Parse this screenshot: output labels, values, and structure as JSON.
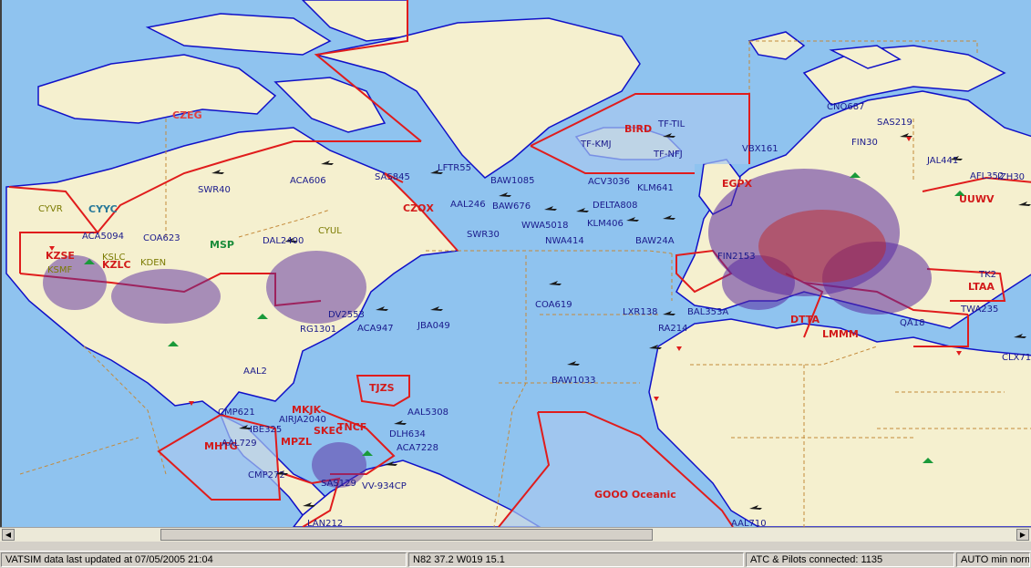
{
  "map": {
    "fir_labels": [
      {
        "id": "fir-czeg",
        "text": "CZEG"
      },
      {
        "id": "fir-bird",
        "text": "BIRD"
      },
      {
        "id": "fir-czqx",
        "text": "CZQX"
      },
      {
        "id": "fir-kzse",
        "text": "KZSE"
      },
      {
        "id": "fir-kzlc",
        "text": "KZLC"
      },
      {
        "id": "fir-ltaa",
        "text": "LTAA"
      },
      {
        "id": "fir-tjzs",
        "text": "TJZS"
      },
      {
        "id": "fir-mkjk",
        "text": "MKJK"
      },
      {
        "id": "fir-mhtg",
        "text": "MHTG"
      },
      {
        "id": "fir-mpzl",
        "text": "MPZL"
      },
      {
        "id": "fir-sken",
        "text": "SKEC"
      },
      {
        "id": "fir-tncf",
        "text": "TNCF"
      },
      {
        "id": "fir-gooo",
        "text": "GOOO Oceanic"
      },
      {
        "id": "fir-egpx",
        "text": "EGPX"
      },
      {
        "id": "fir-lcm",
        "text": "LMMM"
      },
      {
        "id": "fir-uuwv",
        "text": "UUWV"
      },
      {
        "id": "fir-dtta",
        "text": "DTTA"
      }
    ],
    "airport_labels": [
      {
        "id": "apt-cyvr",
        "text": "CYVR"
      },
      {
        "id": "apt-cyul",
        "text": "CYUL"
      },
      {
        "id": "apt-kslc",
        "text": "KSLC"
      },
      {
        "id": "apt-kden",
        "text": "KDEN"
      },
      {
        "id": "apt-ksmf",
        "text": "KSMF"
      }
    ],
    "center_labels": [
      {
        "id": "ctr-cyyc",
        "text": "CYYC"
      },
      {
        "id": "ctr-msp",
        "text": "MSP"
      }
    ],
    "flights": [
      {
        "id": "flt-sas219",
        "text": "SAS219"
      },
      {
        "id": "flt-cno687",
        "text": "CNO687"
      },
      {
        "id": "flt-fin30",
        "text": "FIN30"
      },
      {
        "id": "flt-jal441",
        "text": "JAL441"
      },
      {
        "id": "flt-afl352",
        "text": "AFL352"
      },
      {
        "id": "flt-jzr30",
        "text": "IZH30"
      },
      {
        "id": "flt-vbx161",
        "text": "VBX161"
      },
      {
        "id": "flt-tftil",
        "text": "TF-TIL"
      },
      {
        "id": "flt-tfkmj",
        "text": "TF-KMJ"
      },
      {
        "id": "flt-tfnfj",
        "text": "TF-NFJ"
      },
      {
        "id": "flt-lftr55",
        "text": "LFTR55"
      },
      {
        "id": "flt-baw1085",
        "text": "BAW1085"
      },
      {
        "id": "flt-acv3036",
        "text": "ACV3036"
      },
      {
        "id": "flt-klm641",
        "text": "KLM641"
      },
      {
        "id": "flt-delta808",
        "text": "DELTA808"
      },
      {
        "id": "flt-klm406",
        "text": "KLM406"
      },
      {
        "id": "flt-nwa414",
        "text": "NWA414"
      },
      {
        "id": "flt-baw24a",
        "text": "BAW24A"
      },
      {
        "id": "flt-sas845",
        "text": "SAS845"
      },
      {
        "id": "flt-aca606",
        "text": "ACA606"
      },
      {
        "id": "flt-swr40",
        "text": "SWR40"
      },
      {
        "id": "flt-aal246",
        "text": "AAL246"
      },
      {
        "id": "flt-baw676",
        "text": "BAW676"
      },
      {
        "id": "flt-wwa5018",
        "text": "WWA5018"
      },
      {
        "id": "flt-swr30",
        "text": "SWR30"
      },
      {
        "id": "flt-aca5094",
        "text": "ACA5094"
      },
      {
        "id": "flt-coa623",
        "text": "COA623"
      },
      {
        "id": "flt-dal2400",
        "text": "DAL2400"
      },
      {
        "id": "flt-fin2153",
        "text": "FIN2153"
      },
      {
        "id": "flt-tk2",
        "text": "TK2"
      },
      {
        "id": "flt-coa619",
        "text": "COA619"
      },
      {
        "id": "flt-lxr138",
        "text": "LXR138"
      },
      {
        "id": "flt-bal353a",
        "text": "BAL353A"
      },
      {
        "id": "flt-ra214",
        "text": "RA214"
      },
      {
        "id": "flt-baw1033",
        "text": "BAW1033"
      },
      {
        "id": "flt-aca947",
        "text": "ACA947"
      },
      {
        "id": "flt-jba049",
        "text": "JBA049"
      },
      {
        "id": "flt-dv2553",
        "text": "DV2553"
      },
      {
        "id": "flt-rg1301",
        "text": "RG1301"
      },
      {
        "id": "flt-aal2",
        "text": "AAL2"
      },
      {
        "id": "flt-cmp621",
        "text": "CMP621"
      },
      {
        "id": "flt-ibe325",
        "text": "IBE325"
      },
      {
        "id": "flt-aal729",
        "text": "AAL729"
      },
      {
        "id": "flt-cmp272",
        "text": "CMP272"
      },
      {
        "id": "flt-airja2040",
        "text": "AIRJA2040"
      },
      {
        "id": "flt-aal5308",
        "text": "AAL5308"
      },
      {
        "id": "flt-dlh634",
        "text": "DLH634"
      },
      {
        "id": "flt-aca7228",
        "text": "ACA7228"
      },
      {
        "id": "flt-twa235",
        "text": "TWA235"
      },
      {
        "id": "flt-qa18",
        "text": "QA18"
      },
      {
        "id": "flt-clx71",
        "text": "CLX71"
      },
      {
        "id": "flt-aal710",
        "text": "AAL710"
      },
      {
        "id": "flt-lan212",
        "text": "LAN212"
      },
      {
        "id": "flt-sas129",
        "text": "SAS129"
      },
      {
        "id": "flt-vv934cp",
        "text": "VV-934CP"
      }
    ]
  },
  "status": {
    "updated": "VATSIM data last updated at 07/05/2005 21:04",
    "coords": "N82 37.2   W019 15.1",
    "connected": "ATC & Pilots connected: 1135",
    "mode": "AUTO min norm"
  },
  "scrollbar": {
    "left_arrow": "◀",
    "right_arrow": "▶"
  },
  "colors": {
    "ocean": "#8fc3ef",
    "land": "#f5f0cf",
    "fir_line": "#e01c1c",
    "boundary": "#c48a3a",
    "coast": "#1010c8",
    "label": "#1a1a8c",
    "fir_text": "#d21a1a"
  }
}
